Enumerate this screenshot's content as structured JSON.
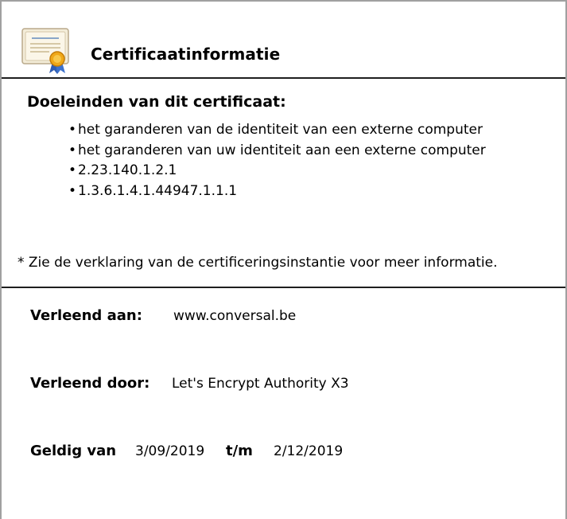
{
  "header": {
    "icon": "certificate-icon",
    "title": "Certificaatinformatie"
  },
  "purposes": {
    "heading": "Doeleinden van dit certificaat:",
    "items": [
      "het garanderen van de identiteit van een externe computer",
      "het garanderen van uw identiteit aan een externe computer",
      "2.23.140.1.2.1",
      "1.3.6.1.4.1.44947.1.1.1"
    ],
    "note": "* Zie de verklaring van de certificeringsinstantie voor meer informatie."
  },
  "details": {
    "issued_to_label": "Verleend aan:",
    "issued_to_value": "www.conversal.be",
    "issued_by_label": "Verleend door:",
    "issued_by_value": "Let's Encrypt Authority X3",
    "valid_from_label": "Geldig van",
    "valid_from_value": "3/09/2019",
    "valid_to_label": "t/m",
    "valid_to_value": "2/12/2019"
  }
}
